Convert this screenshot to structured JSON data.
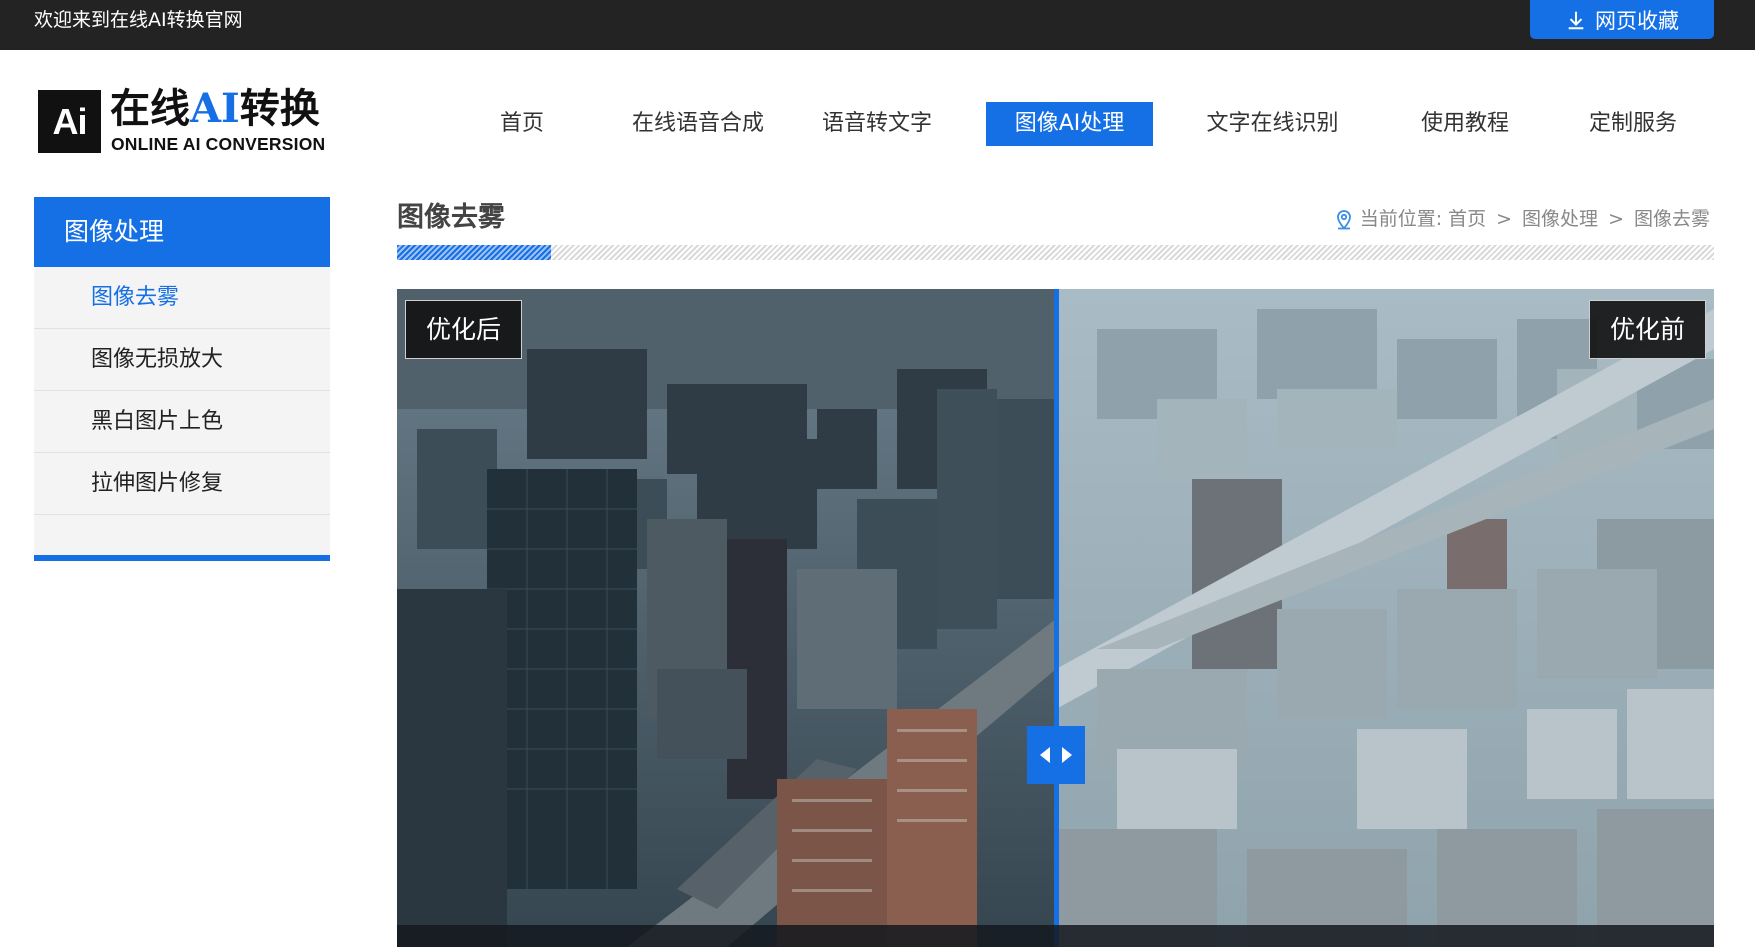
{
  "topbar": {
    "welcome": "欢迎来到在线AI转换官网",
    "favorite_button": "网页收藏",
    "favorite_icon": "download-icon"
  },
  "logo": {
    "badge": "Ai",
    "cn_prefix": "在线",
    "cn_ai": "AI",
    "cn_suffix": "转换",
    "en": "ONLINE AI CONVERSION"
  },
  "nav": {
    "items": [
      {
        "label": "首页",
        "active": false
      },
      {
        "label": "在线语音合成",
        "active": false
      },
      {
        "label": "语音转文字",
        "active": false
      },
      {
        "label": "图像AI处理",
        "active": true
      },
      {
        "label": "文字在线识别",
        "active": false
      },
      {
        "label": "使用教程",
        "active": false
      },
      {
        "label": "定制服务",
        "active": false
      }
    ],
    "accent": "#1570e5"
  },
  "sidebar": {
    "title": "图像处理",
    "items": [
      {
        "label": "图像去雾",
        "current": true
      },
      {
        "label": "图像无损放大",
        "current": false
      },
      {
        "label": "黑白图片上色",
        "current": false
      },
      {
        "label": "拉伸图片修复",
        "current": false
      }
    ]
  },
  "content": {
    "title": "图像去雾",
    "breadcrumb": {
      "icon": "location-pin-icon",
      "prefix": "当前位置:",
      "crumbs": [
        "首页",
        "图像处理",
        "图像去雾"
      ],
      "separator": ">"
    }
  },
  "viewer": {
    "after_label": "优化后",
    "before_label": "优化前",
    "handle_icon": "left-right-arrows-icon",
    "divider_position": 0.5
  }
}
